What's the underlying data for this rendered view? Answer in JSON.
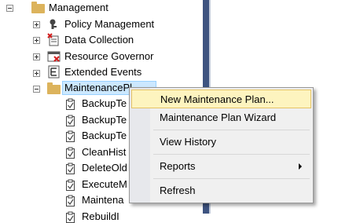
{
  "tree": {
    "management": {
      "label": "Management"
    },
    "children": [
      {
        "label": "Policy Management",
        "icon": "policy-icon"
      },
      {
        "label": "Data Collection",
        "icon": "data-collection-icon"
      },
      {
        "label": "Resource Governor",
        "icon": "resource-governor-icon"
      },
      {
        "label": "Extended Events",
        "icon": "extended-events-icon"
      }
    ],
    "maintenance_plans": {
      "label": "MaintenancePl"
    },
    "plans": [
      {
        "label": "BackupTe"
      },
      {
        "label": "BackupTe"
      },
      {
        "label": "BackupTe"
      },
      {
        "label": "CleanHist"
      },
      {
        "label": "DeleteOld"
      },
      {
        "label": "ExecuteM"
      },
      {
        "label": "Maintena"
      },
      {
        "label": "RebuildI"
      }
    ]
  },
  "context_menu": {
    "items": [
      {
        "label": "New Maintenance Plan..."
      },
      {
        "label": "Maintenance Plan Wizard"
      },
      {
        "label": "View History"
      },
      {
        "label": "Reports",
        "submenu": true
      },
      {
        "label": "Refresh"
      }
    ]
  },
  "colors": {
    "selection": "#cce8ff",
    "menu_highlight": "#fdf4bf",
    "folder": "#dcb35c",
    "panel_divider": "#3e5480"
  }
}
